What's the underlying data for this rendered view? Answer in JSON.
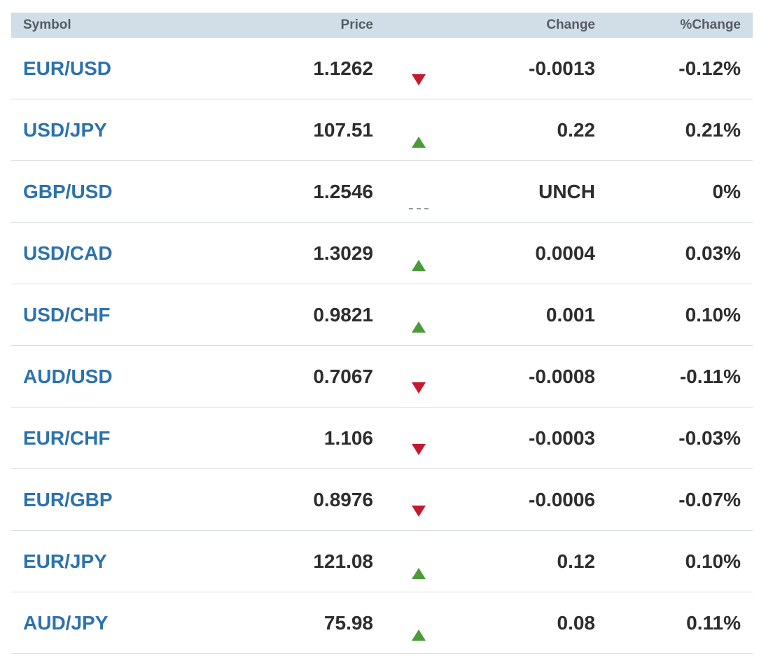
{
  "header": {
    "symbol": "Symbol",
    "price": "Price",
    "change": "Change",
    "pct_change": "%Change"
  },
  "colors": {
    "symbol_link": "#2c72ad",
    "up": "#4c9b3a",
    "down": "#c5192d",
    "unchanged": "#9a9a9a",
    "header_bg": "#d1dde7"
  },
  "rows": [
    {
      "symbol": "EUR/USD",
      "price": "1.1262",
      "direction": "down",
      "direction_icon": "triangle-down-icon",
      "change": "-0.0013",
      "pct": "-0.12%"
    },
    {
      "symbol": "USD/JPY",
      "price": "107.51",
      "direction": "up",
      "direction_icon": "triangle-up-icon",
      "change": "0.22",
      "pct": "0.21%"
    },
    {
      "symbol": "GBP/USD",
      "price": "1.2546",
      "direction": "unch",
      "direction_icon": "dash-icon",
      "change": "UNCH",
      "pct": "0%"
    },
    {
      "symbol": "USD/CAD",
      "price": "1.3029",
      "direction": "up",
      "direction_icon": "triangle-up-icon",
      "change": "0.0004",
      "pct": "0.03%"
    },
    {
      "symbol": "USD/CHF",
      "price": "0.9821",
      "direction": "up",
      "direction_icon": "triangle-up-icon",
      "change": "0.001",
      "pct": "0.10%"
    },
    {
      "symbol": "AUD/USD",
      "price": "0.7067",
      "direction": "down",
      "direction_icon": "triangle-down-icon",
      "change": "-0.0008",
      "pct": "-0.11%"
    },
    {
      "symbol": "EUR/CHF",
      "price": "1.106",
      "direction": "down",
      "direction_icon": "triangle-down-icon",
      "change": "-0.0003",
      "pct": "-0.03%"
    },
    {
      "symbol": "EUR/GBP",
      "price": "0.8976",
      "direction": "down",
      "direction_icon": "triangle-down-icon",
      "change": "-0.0006",
      "pct": "-0.07%"
    },
    {
      "symbol": "EUR/JPY",
      "price": "121.08",
      "direction": "up",
      "direction_icon": "triangle-up-icon",
      "change": "0.12",
      "pct": "0.10%"
    },
    {
      "symbol": "AUD/JPY",
      "price": "75.98",
      "direction": "up",
      "direction_icon": "triangle-up-icon",
      "change": "0.08",
      "pct": "0.11%"
    }
  ]
}
